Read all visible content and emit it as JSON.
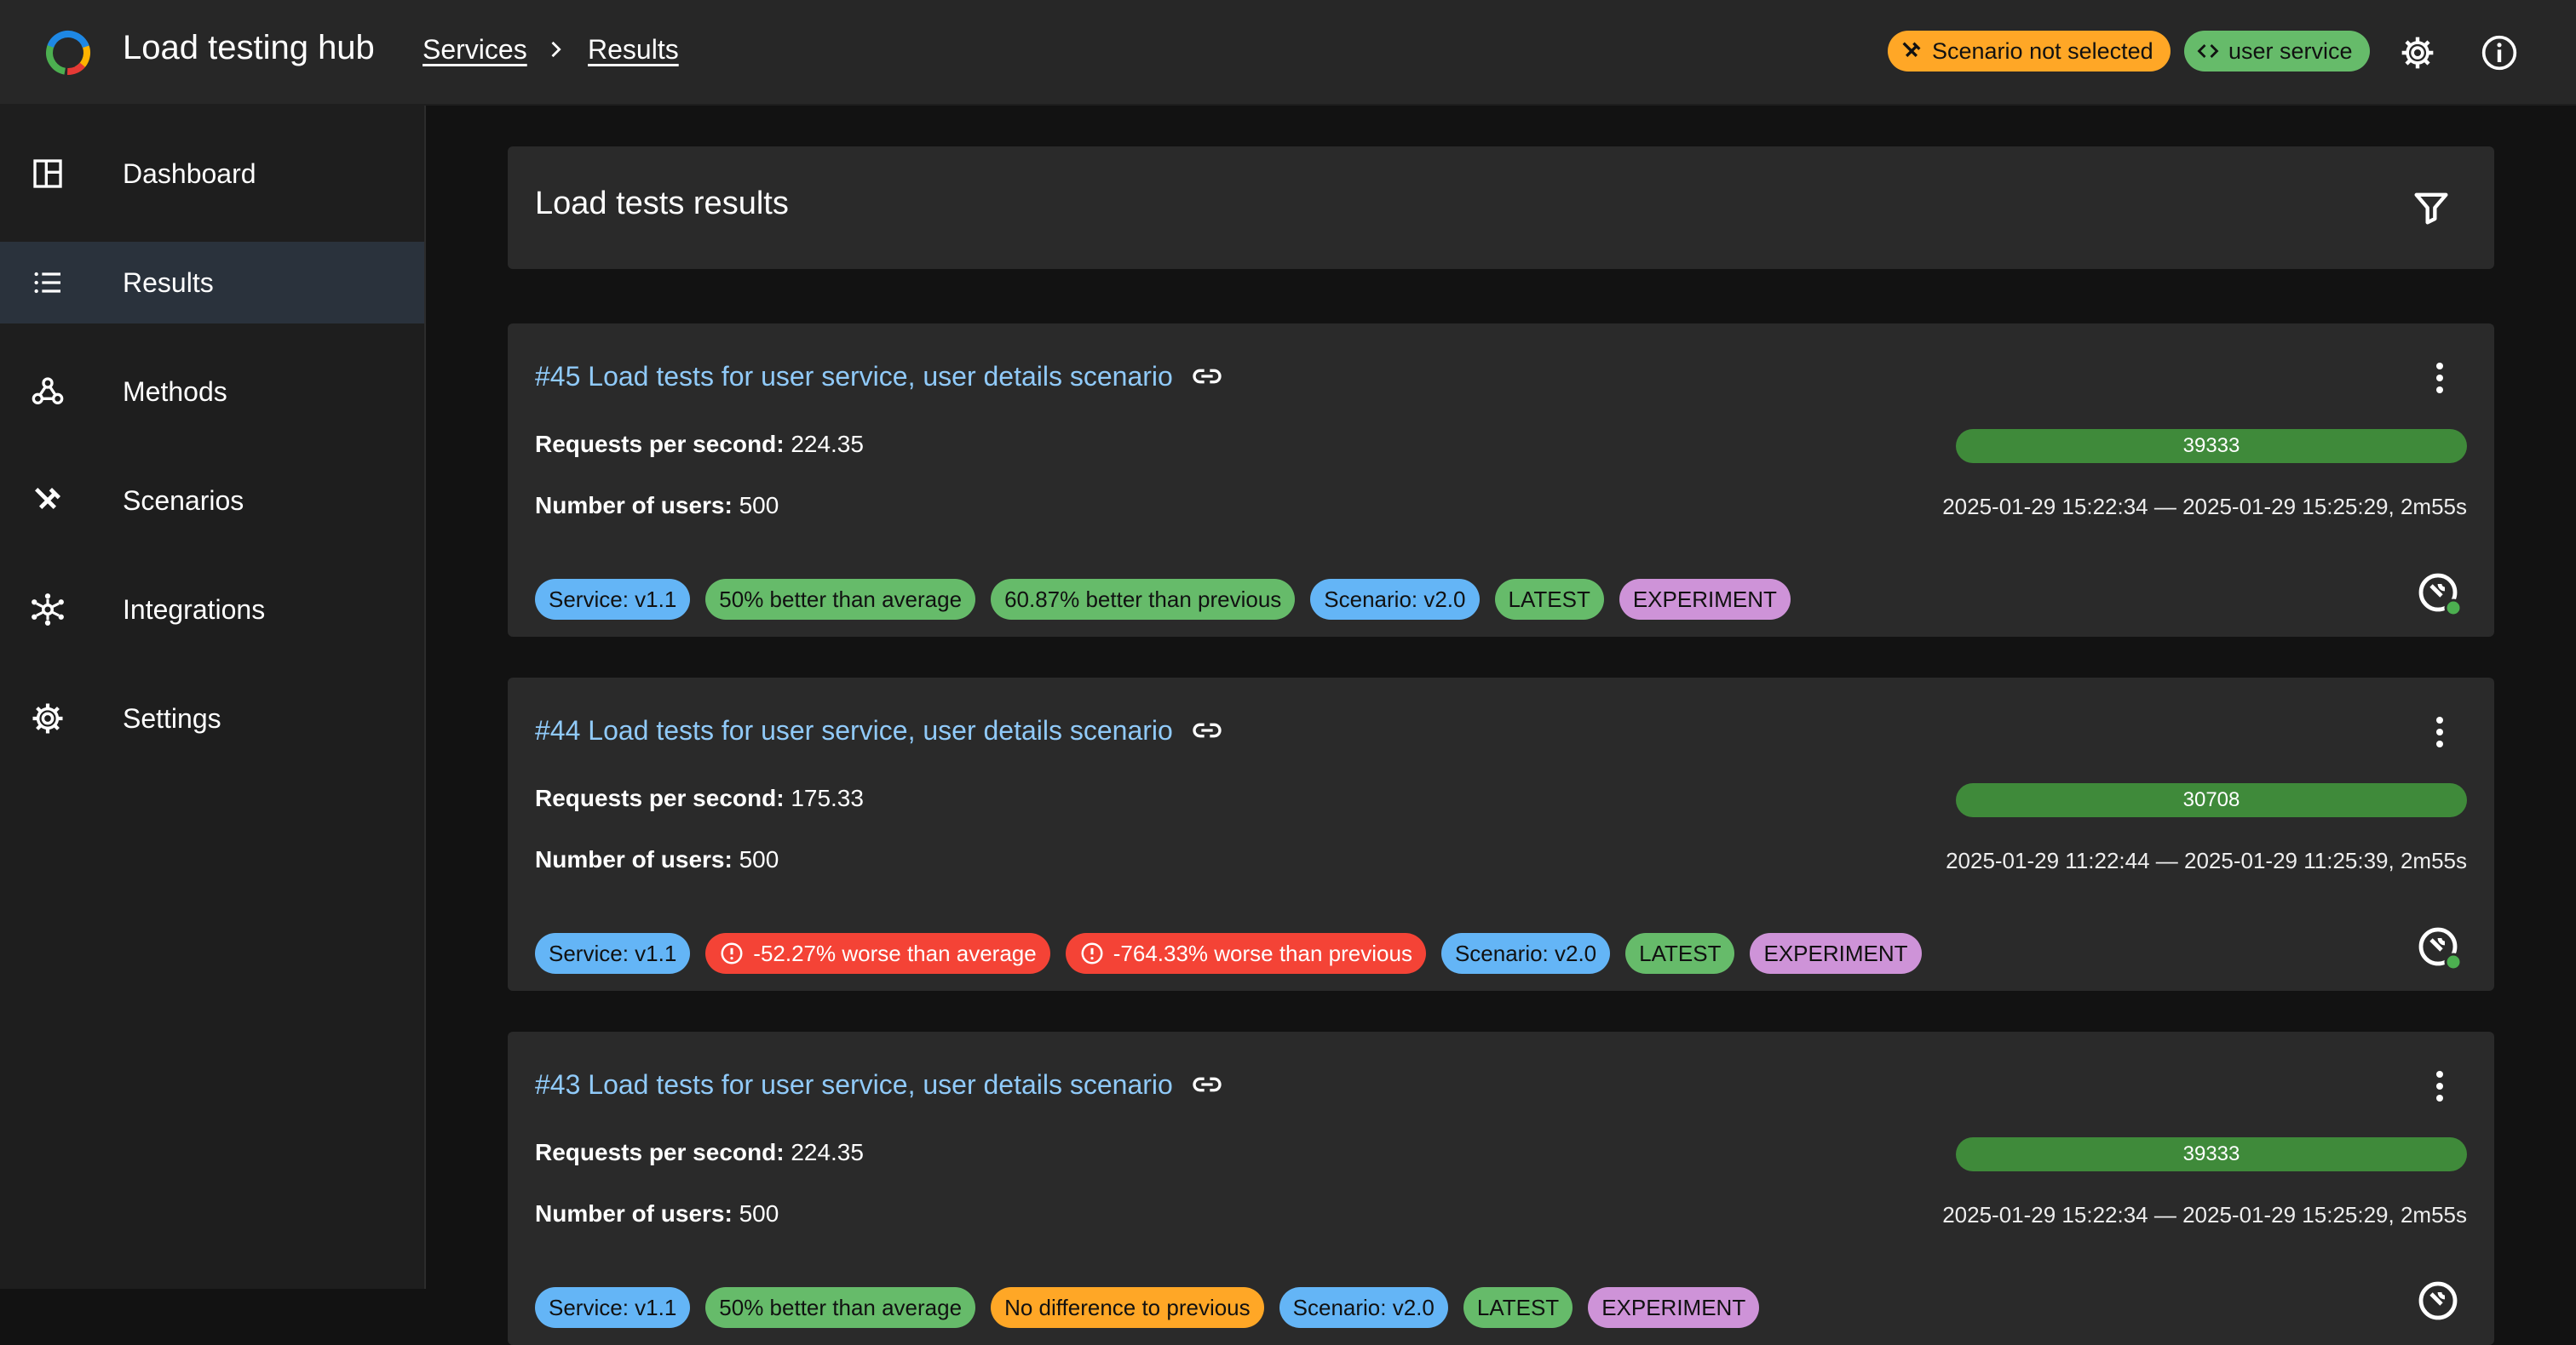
{
  "app": {
    "title": "Load testing hub",
    "breadcrumbs": [
      "Services",
      "Results"
    ],
    "scenario_chip": "Scenario not selected",
    "service_chip": "user service"
  },
  "sidebar": {
    "items": [
      {
        "label": "Dashboard",
        "icon": "dashboard-icon"
      },
      {
        "label": "Results",
        "icon": "list-icon",
        "active": true
      },
      {
        "label": "Methods",
        "icon": "webhook-icon"
      },
      {
        "label": "Scenarios",
        "icon": "tools-icon"
      },
      {
        "label": "Integrations",
        "icon": "hub-icon"
      },
      {
        "label": "Settings",
        "icon": "gear-icon"
      }
    ]
  },
  "main": {
    "title": "Load tests results",
    "results": [
      {
        "title": "#45 Load tests for user service, user details scenario",
        "rps_label": "Requests per second:",
        "rps": "224.35",
        "users_label": "Number of users:",
        "users": "500",
        "bar_value": "39333",
        "date_range": "2025-01-29 15:22:34 — 2025-01-29 15:25:29, 2m55s",
        "chips": [
          {
            "text": "Service: v1.1",
            "color": "blue"
          },
          {
            "text": "50% better than average",
            "color": "green"
          },
          {
            "text": "60.87% better than previous",
            "color": "green"
          },
          {
            "text": "Scenario: v2.0",
            "color": "blue"
          },
          {
            "text": "LATEST",
            "color": "green"
          },
          {
            "text": "EXPERIMENT",
            "color": "purple"
          }
        ]
      },
      {
        "title": "#44 Load tests for user service, user details scenario",
        "rps_label": "Requests per second:",
        "rps": "175.33",
        "users_label": "Number of users:",
        "users": "500",
        "bar_value": "30708",
        "date_range": "2025-01-29 11:22:44 — 2025-01-29 11:25:39, 2m55s",
        "chips": [
          {
            "text": "Service: v1.1",
            "color": "blue"
          },
          {
            "text": "-52.27% worse than average",
            "color": "red",
            "icon": "error-icon"
          },
          {
            "text": "-764.33% worse than previous",
            "color": "red",
            "icon": "error-icon"
          },
          {
            "text": "Scenario: v2.0",
            "color": "blue"
          },
          {
            "text": "LATEST",
            "color": "green"
          },
          {
            "text": "EXPERIMENT",
            "color": "purple"
          }
        ]
      },
      {
        "title": "#43 Load tests for user service, user details scenario",
        "rps_label": "Requests per second:",
        "rps": "224.35",
        "users_label": "Number of users:",
        "users": "500",
        "bar_value": "39333",
        "date_range": "2025-01-29 15:22:34 — 2025-01-29 15:25:29, 2m55s",
        "chips": [
          {
            "text": "Service: v1.1",
            "color": "blue"
          },
          {
            "text": "50% better than average",
            "color": "green"
          },
          {
            "text": "No difference to previous",
            "color": "orange"
          },
          {
            "text": "Scenario: v2.0",
            "color": "blue"
          },
          {
            "text": "LATEST",
            "color": "green"
          },
          {
            "text": "EXPERIMENT",
            "color": "purple"
          }
        ]
      }
    ]
  },
  "colors": {
    "accent_link": "#90caf9",
    "success": "#66bb6a",
    "error": "#f44336",
    "warning": "#ffa726",
    "info": "#64b5f6",
    "purple": "#ce93d8"
  }
}
